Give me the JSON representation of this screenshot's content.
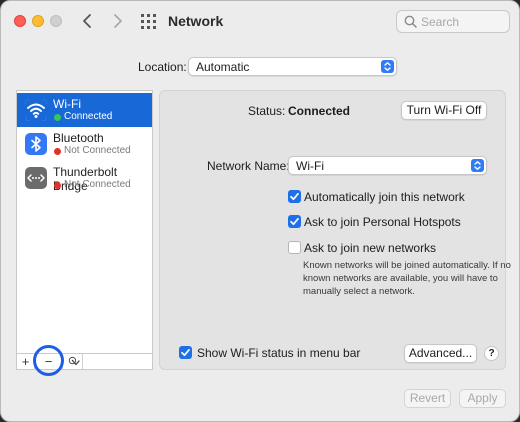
{
  "window": {
    "title": "Network"
  },
  "search": {
    "placeholder": "Search"
  },
  "location": {
    "label": "Location:",
    "value": "Automatic"
  },
  "services": [
    {
      "name": "Wi-Fi",
      "status": "Connected",
      "status_color": "#34c759",
      "icon": "wifi-icon",
      "selected": true
    },
    {
      "name": "Bluetooth",
      "status": "Not Connected",
      "status_color": "#e0322b",
      "icon": "bluetooth-icon",
      "selected": false
    },
    {
      "name": "Thunderbolt Bridge",
      "status": "Not Connected",
      "status_color": "#e0322b",
      "icon": "thunderbolt-bridge-icon",
      "selected": false
    }
  ],
  "sidebar_toolbar": {
    "add": "+",
    "remove": "−",
    "actions": "⊙"
  },
  "detail": {
    "status_label": "Status:",
    "status_value": "Connected",
    "toggle_button": "Turn Wi-Fi Off",
    "network_name_label": "Network Name:",
    "network_name_value": "Wi-Fi",
    "options": [
      {
        "label": "Automatically join this network",
        "checked": true
      },
      {
        "label": "Ask to join Personal Hotspots",
        "checked": true
      },
      {
        "label": "Ask to join new networks",
        "checked": false
      }
    ],
    "note": "Known networks will be joined automatically. If no known networks are available, you will have to manually select a network.",
    "show_status_label": "Show Wi-Fi status in menu bar",
    "show_status_checked": true,
    "advanced_button": "Advanced...",
    "help": "?"
  },
  "footer": {
    "revert": "Revert",
    "apply": "Apply"
  },
  "colors": {
    "accent": "#1f6fe8",
    "selection": "#1868d8"
  }
}
